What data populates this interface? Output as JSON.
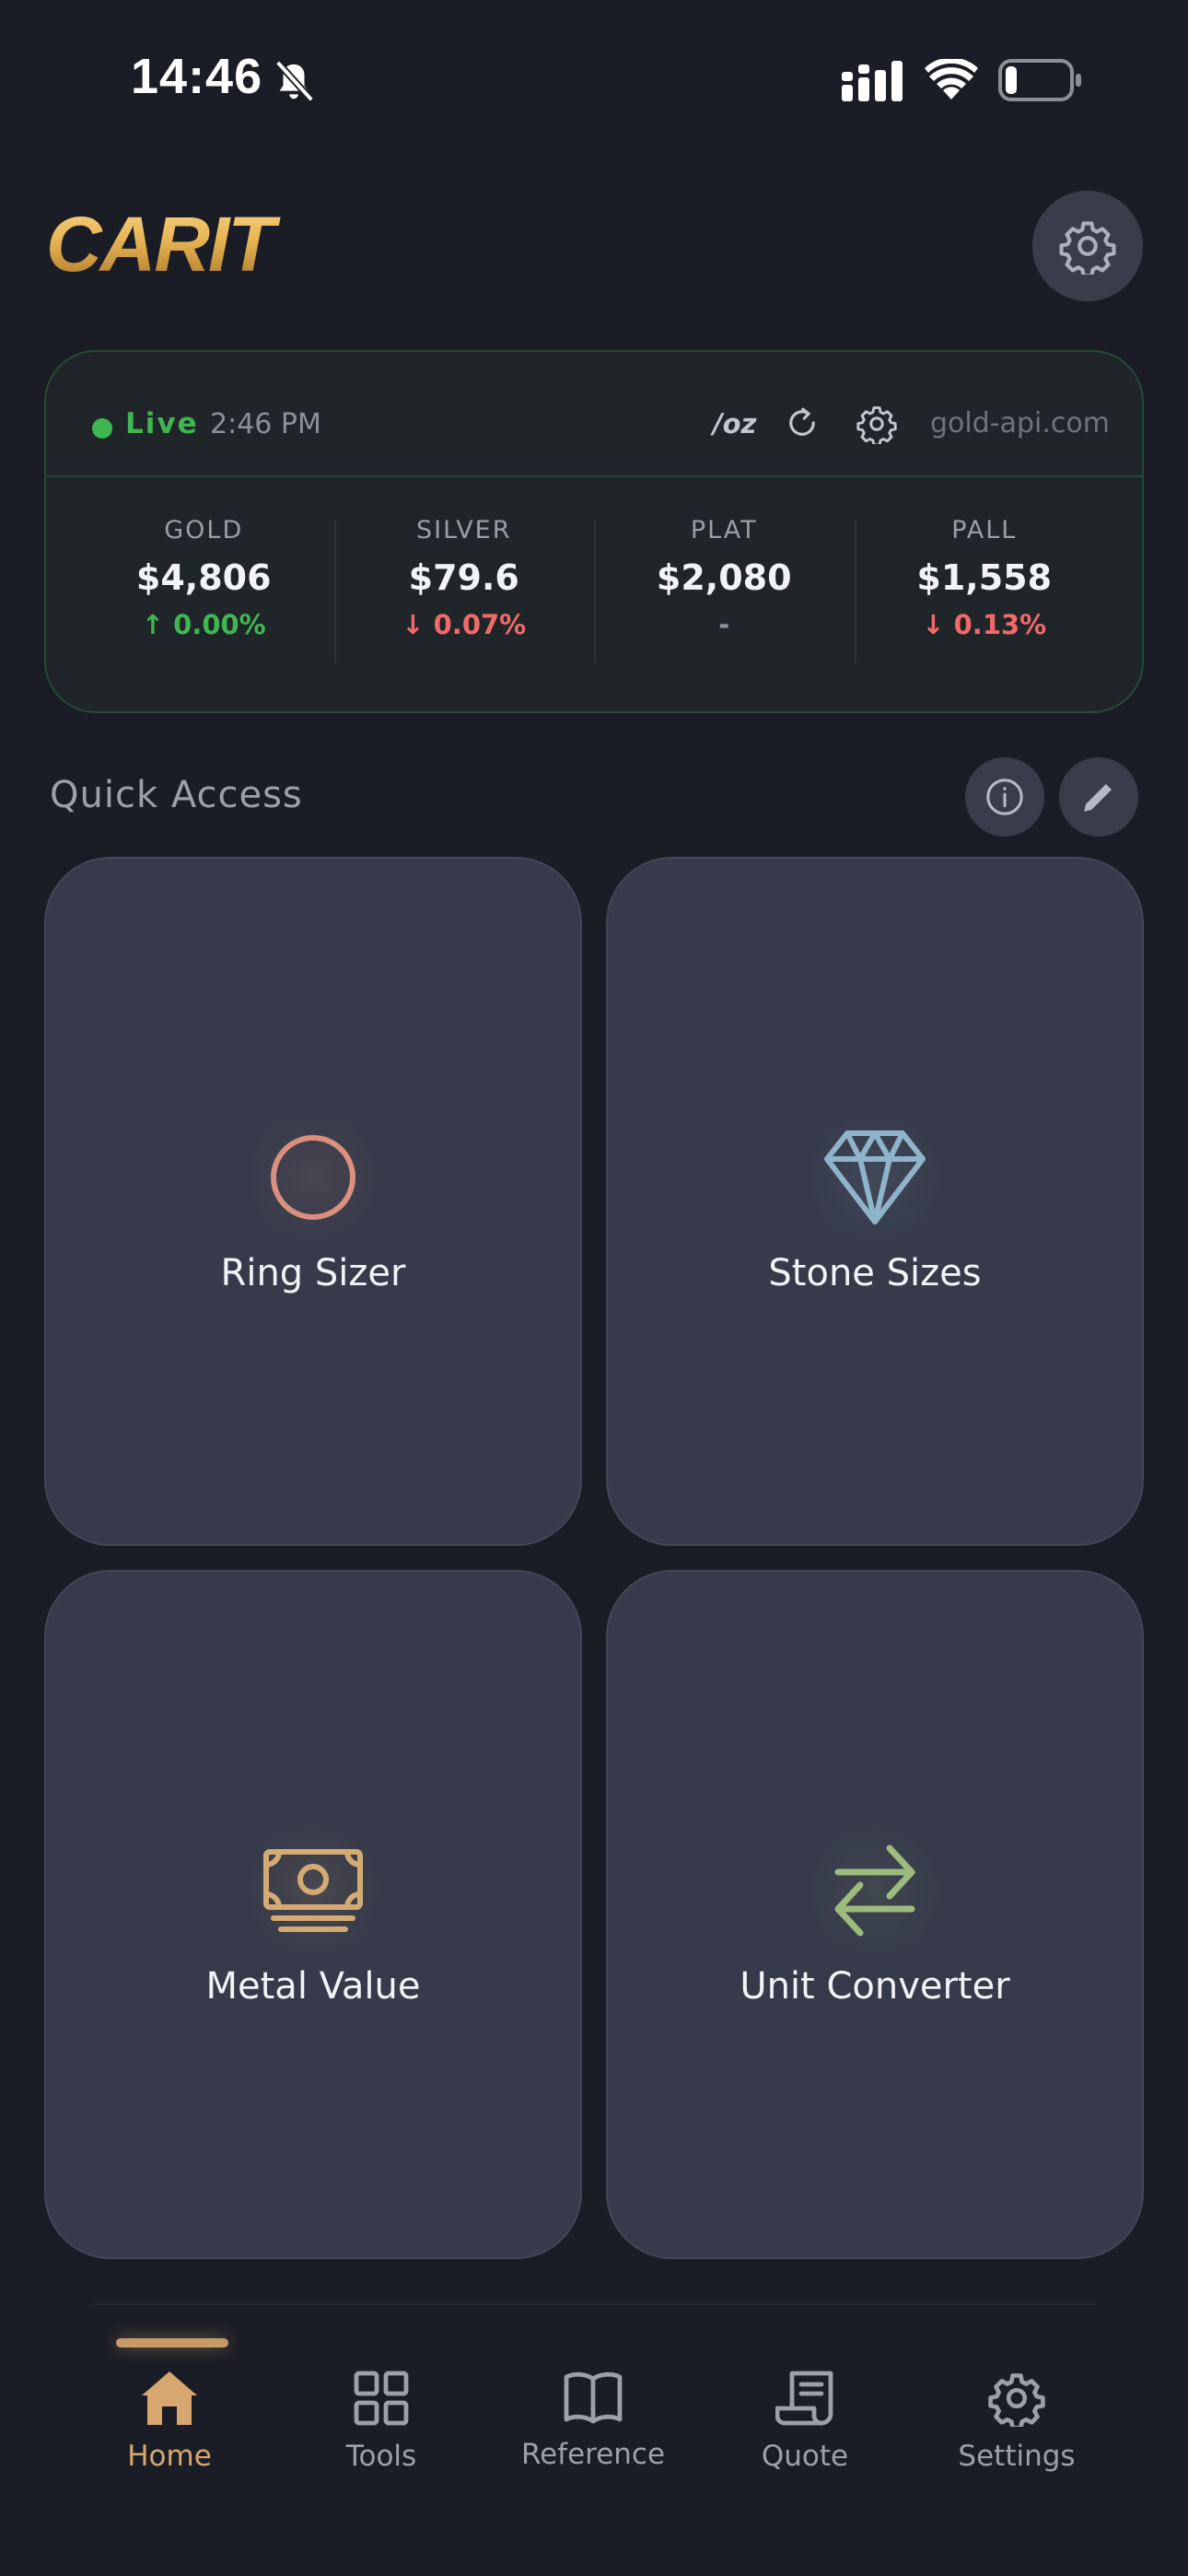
{
  "status_bar": {
    "time": "14:46"
  },
  "header": {
    "logo_text": "CARIT",
    "settings_icon": "gear-icon"
  },
  "price_card": {
    "live_label": "Live",
    "updated_time": "2:46 PM",
    "unit": "/oz",
    "source": "gold-api.com",
    "metals": [
      {
        "name": "GOLD",
        "price": "$4,806",
        "change": "↑ 0.00%",
        "direction": "up"
      },
      {
        "name": "SILVER",
        "price": "$79.6",
        "change": "↓ 0.07%",
        "direction": "down"
      },
      {
        "name": "PLAT",
        "price": "$2,080",
        "change": "-",
        "direction": "flat"
      },
      {
        "name": "PALL",
        "price": "$1,558",
        "change": "↓ 0.13%",
        "direction": "down"
      }
    ]
  },
  "quick_access": {
    "title": "Quick Access",
    "tiles": [
      {
        "label": "Ring Sizer",
        "icon": "ring-icon",
        "color": "#d9907e"
      },
      {
        "label": "Stone Sizes",
        "icon": "diamond-icon",
        "color": "#8fb3c8"
      },
      {
        "label": "Metal Value",
        "icon": "banknote-icon",
        "color": "#d3aa72"
      },
      {
        "label": "Unit Converter",
        "icon": "swap-arrows-icon",
        "color": "#9cbb7c"
      }
    ]
  },
  "nav": {
    "items": [
      {
        "label": "Home",
        "icon": "home-icon",
        "active": true
      },
      {
        "label": "Tools",
        "icon": "grid-icon",
        "active": false
      },
      {
        "label": "Reference",
        "icon": "book-icon",
        "active": false
      },
      {
        "label": "Quote",
        "icon": "receipt-icon",
        "active": false
      },
      {
        "label": "Settings",
        "icon": "gear-icon",
        "active": false
      }
    ]
  },
  "colors": {
    "background": "#1b1d26",
    "accent": "#d6a76f",
    "live_green": "#3fb652",
    "down_red": "#f06a6a"
  }
}
